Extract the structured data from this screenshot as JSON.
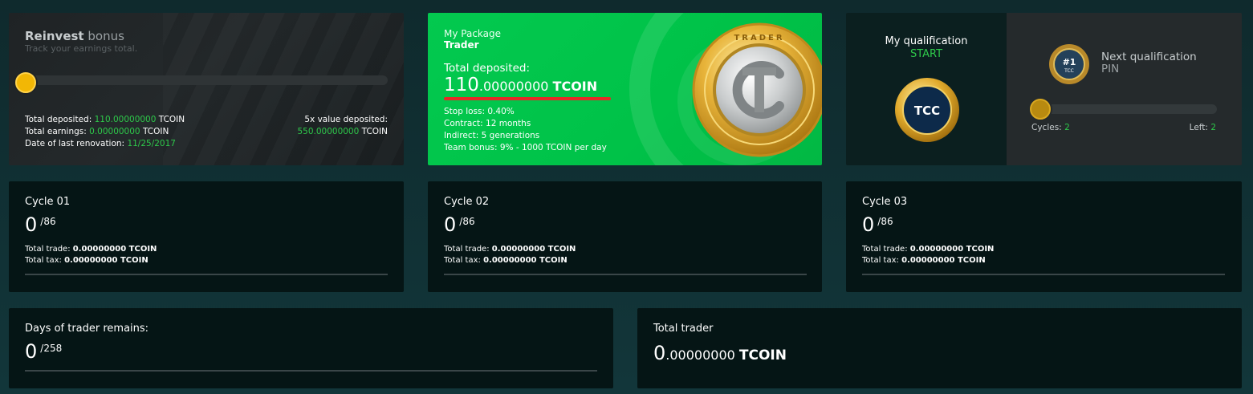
{
  "reinvest": {
    "title_bold": "Reinvest",
    "title_rest": "bonus",
    "subtitle": "Track your earnings total.",
    "progress": 0,
    "total_deposited_label": "Total deposited:",
    "total_deposited_value": "110.00000000",
    "total_deposited_unit": "TCOIN",
    "total_earnings_label": "Total earnings:",
    "total_earnings_value": "0.00000000",
    "total_earnings_unit": "TCOIN",
    "last_renovation_label": "Date of last renovation:",
    "last_renovation_value": "11/25/2017",
    "five_x_label": "5x value deposited:",
    "five_x_value": "550.00000000",
    "five_x_unit": "TCOIN"
  },
  "package": {
    "label": "My Package",
    "name": "Trader",
    "deposited_label": "Total deposited:",
    "deposited_int": "110",
    "deposited_dec": ".00000000",
    "deposited_unit": "TCOIN",
    "stop_loss": "Stop loss: 0.40%",
    "contract": "Contract: 12 months",
    "indirect": "Indirect: 5 generations",
    "team_bonus": "Team bonus: 9% - 1000 TCOIN per day",
    "coin_icon": "trader-coin-icon",
    "coin_text": "TRADER"
  },
  "qualification": {
    "title": "My qualification",
    "status": "START",
    "badge_text": "TCC",
    "next_title": "Next qualification",
    "next_status": "PIN",
    "next_badge_rank": "#1",
    "next_badge_text": "TCC",
    "progress": 0,
    "cycles_label": "Cycles:",
    "cycles_value": "2",
    "left_label": "Left:",
    "left_value": "2"
  },
  "cycles": [
    {
      "title": "Cycle 01",
      "count": "0",
      "total": "/86",
      "trade_label": "Total trade:",
      "trade_value": "0.00000000 TCOIN",
      "tax_label": "Total tax:",
      "tax_value": "0.00000000 TCOIN"
    },
    {
      "title": "Cycle 02",
      "count": "0",
      "total": "/86",
      "trade_label": "Total trade:",
      "trade_value": "0.00000000 TCOIN",
      "tax_label": "Total tax:",
      "tax_value": "0.00000000 TCOIN"
    },
    {
      "title": "Cycle 03",
      "count": "0",
      "total": "/86",
      "trade_label": "Total trade:",
      "trade_value": "0.00000000 TCOIN",
      "tax_label": "Total tax:",
      "tax_value": "0.00000000 TCOIN"
    }
  ],
  "days": {
    "title": "Days of trader remains:",
    "count": "0",
    "total": "/258"
  },
  "total_trader": {
    "title": "Total trader",
    "int": "0",
    "dec": ".00000000",
    "unit": "TCOIN"
  },
  "colors": {
    "accent_green": "#2ec84a",
    "package_green": "#00c248",
    "gold": "#f2b705",
    "underline_red": "#e52a27",
    "page_bg": "#0f2b2e",
    "card_bg": "#051515"
  }
}
